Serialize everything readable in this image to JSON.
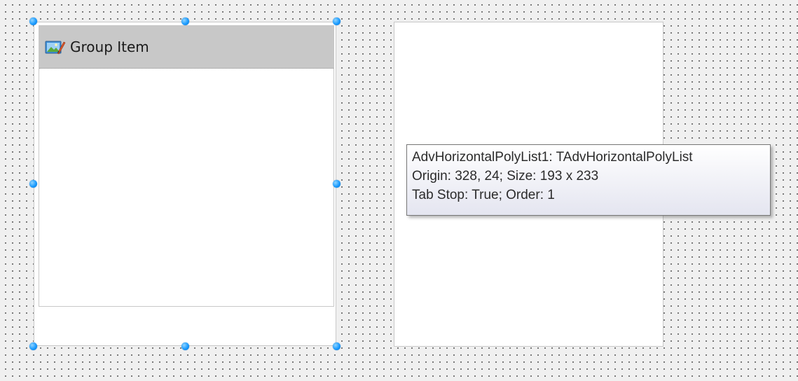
{
  "designer": {
    "left_control": {
      "group_item": {
        "title": "Group Item",
        "icon": "group-item-image-icon"
      }
    },
    "tooltip": {
      "line1": "AdvHorizontalPolyList1: TAdvHorizontalPolyList",
      "line2": "Origin: 328, 24; Size: 193 x 233",
      "line3": "Tab Stop: True; Order: 1"
    },
    "colors": {
      "selection_handle": "#1a9bff",
      "group_header": "#c8c8c8",
      "canvas": "#f0f0f0"
    }
  }
}
